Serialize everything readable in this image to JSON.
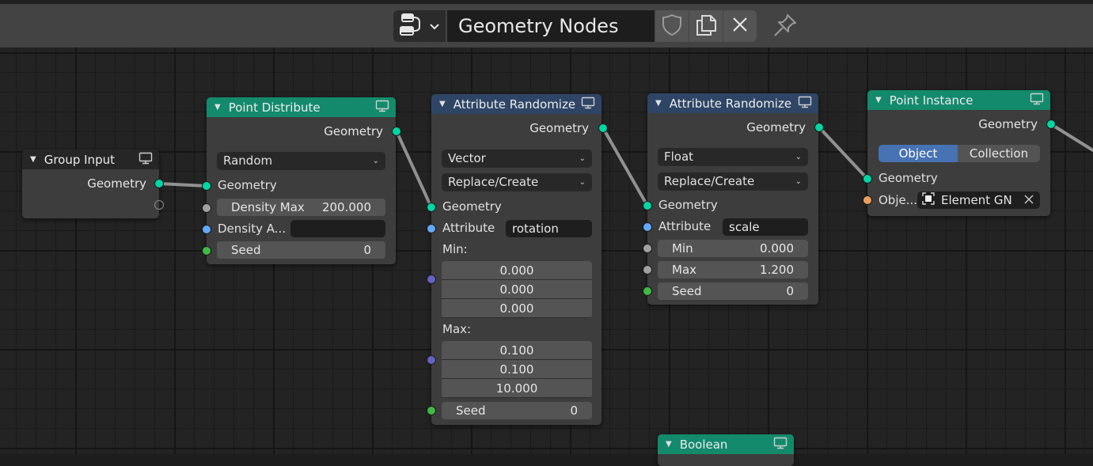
{
  "header": {
    "editor_type_icon": "node-editor-icon",
    "node_tree_name": "Geometry Nodes",
    "fake_user_icon": "shield-icon",
    "duplicate_icon": "duplicate-icon",
    "unlink_icon": "close-icon",
    "pin_icon": "pin-icon"
  },
  "nodes": {
    "group_input": {
      "title": "Group Input",
      "outputs": [
        "Geometry"
      ]
    },
    "point_distribute": {
      "title": "Point Distribute",
      "output": "Geometry",
      "mode": "Random",
      "inputs": {
        "geometry": "Geometry",
        "density_max_label": "Density Max",
        "density_max_value": "200.000",
        "density_attribute_label": "Density A...",
        "density_attribute_value": "",
        "seed_label": "Seed",
        "seed_value": "0"
      }
    },
    "attr_randomize_1": {
      "title": "Attribute Randomize",
      "output": "Geometry",
      "data_type": "Vector",
      "operation": "Replace/Create",
      "inputs": {
        "geometry": "Geometry",
        "attribute_label": "Attribute",
        "attribute_value": "rotation",
        "min_label": "Min:",
        "min_values": [
          "0.000",
          "0.000",
          "0.000"
        ],
        "max_label": "Max:",
        "max_values": [
          "0.100",
          "0.100",
          "10.000"
        ],
        "seed_label": "Seed",
        "seed_value": "0"
      }
    },
    "attr_randomize_2": {
      "title": "Attribute Randomize",
      "output": "Geometry",
      "data_type": "Float",
      "operation": "Replace/Create",
      "inputs": {
        "geometry": "Geometry",
        "attribute_label": "Attribute",
        "attribute_value": "scale",
        "min_label": "Min",
        "min_value": "0.000",
        "max_label": "Max",
        "max_value": "1.200",
        "seed_label": "Seed",
        "seed_value": "0"
      }
    },
    "point_instance": {
      "title": "Point Instance",
      "output": "Geometry",
      "mode_options": [
        "Object",
        "Collection"
      ],
      "mode_selected": "Object",
      "inputs": {
        "geometry": "Geometry",
        "object_label": "Obje...",
        "object_value": "Element GN"
      }
    },
    "boolean": {
      "title": "Boolean"
    }
  },
  "colors": {
    "geometry_socket": "#00d6a3",
    "float_socket": "#a1a1a1",
    "string_socket": "#63a9ff",
    "int_socket": "#3fba45",
    "vector_socket": "#6363c7",
    "object_socket": "#ed9e5c",
    "geometry_header": "#138a6c",
    "attribute_header": "#2f4566",
    "selected_option": "#4772b3"
  }
}
